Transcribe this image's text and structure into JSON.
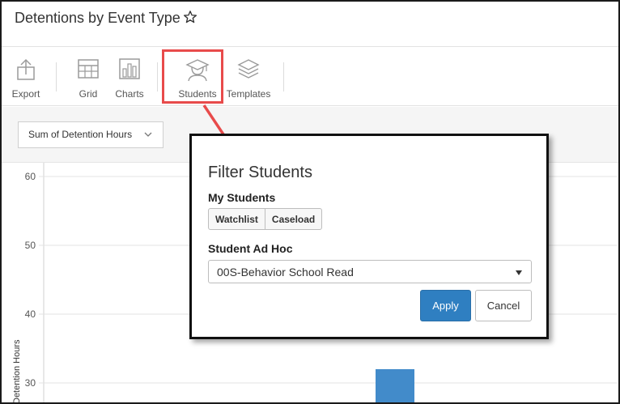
{
  "header": {
    "title": "Detentions by Event Type"
  },
  "toolbar": {
    "items": [
      {
        "label": "Export",
        "icon": "export-icon"
      },
      {
        "label": "Grid",
        "icon": "grid-icon"
      },
      {
        "label": "Charts",
        "icon": "bar-chart-icon"
      },
      {
        "label": "Students",
        "icon": "student-cap-icon"
      },
      {
        "label": "Templates",
        "icon": "layers-icon"
      }
    ],
    "highlight_color": "#e84b4b"
  },
  "metric_select": {
    "value": "Sum of Detention Hours"
  },
  "chart_data": {
    "type": "bar",
    "ylabel": "Detention Hours",
    "y_ticks": [
      60,
      50,
      40,
      30
    ],
    "ylim": [
      28,
      61
    ],
    "series": [
      {
        "values": [
          32
        ]
      }
    ],
    "bar_color": "#428bca",
    "grid": true
  },
  "modal": {
    "title": "Filter Students",
    "my_students_label": "My Students",
    "my_students_buttons": [
      "Watchlist",
      "Caseload"
    ],
    "adhoc_label": "Student Ad Hoc",
    "adhoc_value": "00S-Behavior School Read",
    "apply_label": "Apply",
    "cancel_label": "Cancel",
    "apply_color": "#2f7fc1"
  }
}
